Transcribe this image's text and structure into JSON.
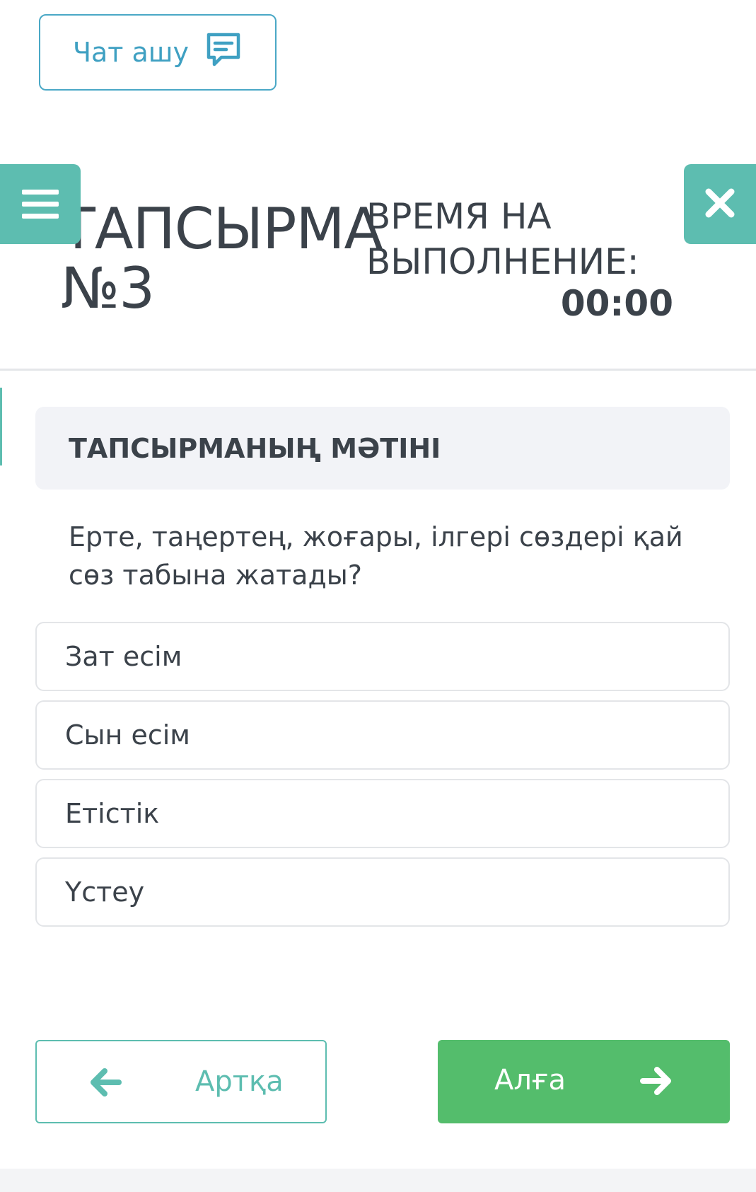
{
  "chat": {
    "label": "Чат ашу",
    "icon": "chat-icon"
  },
  "menu": {
    "icon": "hamburger-menu-icon"
  },
  "close": {
    "icon": "close-icon"
  },
  "task": {
    "title_line1": "ТАПСЫРМА",
    "title_line2": "№3"
  },
  "timer": {
    "label_line1": "ВРЕМЯ НА",
    "label_line2": "ВЫПОЛНЕНИЕ:",
    "value": "00:00"
  },
  "task_text": {
    "header": "ТАПСЫРМАНЫҢ МӘТІНІ",
    "question": "Ерте, таңертең, жоғары, ілгері сөздері қай сөз табына жатады?"
  },
  "options": [
    {
      "label": "Зат есім"
    },
    {
      "label": "Сын есім"
    },
    {
      "label": "Етістік"
    },
    {
      "label": "Үстеу"
    }
  ],
  "navigation": {
    "back_label": "Артқа",
    "back_icon": "arrow-left-icon",
    "next_label": "Алға",
    "next_icon": "arrow-right-icon"
  },
  "colors": {
    "accent_teal": "#5dbdb0",
    "chat_blue": "#3fa0c2",
    "next_green": "#54bd6c",
    "text_dark": "#3b424a"
  }
}
